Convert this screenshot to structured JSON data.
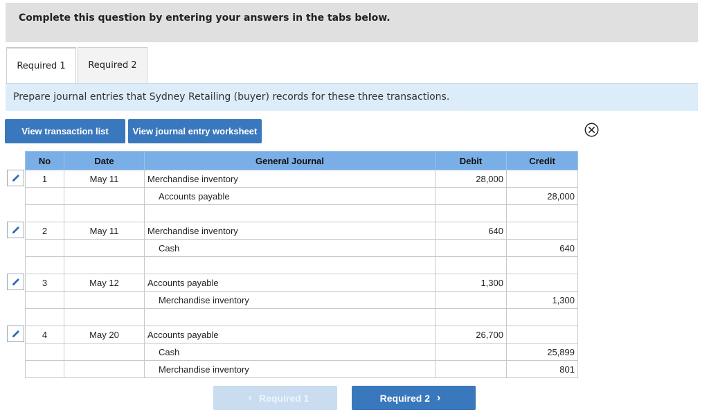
{
  "banner": {
    "text": "Complete this question by entering your answers in the tabs below."
  },
  "tabs": [
    {
      "label": "Required 1",
      "active": true
    },
    {
      "label": "Required 2",
      "active": false
    }
  ],
  "instruction": "Prepare journal entries that Sydney Retailing (buyer) records for these three transactions.",
  "buttons": {
    "transaction_list": "View transaction list",
    "journal_worksheet": "View journal entry worksheet"
  },
  "journal": {
    "headers": {
      "no": "No",
      "date": "Date",
      "general_journal": "General Journal",
      "debit": "Debit",
      "credit": "Credit"
    },
    "entries": [
      {
        "no": "1",
        "date": "May 11",
        "lines": [
          {
            "account": "Merchandise inventory",
            "debit": "28,000",
            "credit": ""
          },
          {
            "account": "Accounts payable",
            "debit": "",
            "credit": "28,000"
          }
        ]
      },
      {
        "no": "2",
        "date": "May 11",
        "lines": [
          {
            "account": "Merchandise inventory",
            "debit": "640",
            "credit": ""
          },
          {
            "account": "Cash",
            "debit": "",
            "credit": "640"
          }
        ]
      },
      {
        "no": "3",
        "date": "May 12",
        "lines": [
          {
            "account": "Accounts payable",
            "debit": "1,300",
            "credit": ""
          },
          {
            "account": "Merchandise inventory",
            "debit": "",
            "credit": "1,300"
          }
        ]
      },
      {
        "no": "4",
        "date": "May 20",
        "lines": [
          {
            "account": "Accounts payable",
            "debit": "26,700",
            "credit": ""
          },
          {
            "account": "Cash",
            "debit": "",
            "credit": "25,899"
          },
          {
            "account": "Merchandise inventory",
            "debit": "",
            "credit": "801"
          }
        ]
      }
    ]
  },
  "nav": {
    "prev_label": "Required 1",
    "next_label": "Required 2"
  },
  "icons": {
    "edit": "pencil-icon",
    "close": "close-circle-icon",
    "prev": "chevron-left-icon",
    "next": "chevron-right-icon"
  },
  "colors": {
    "button_blue": "#3a78bd",
    "header_blue": "#7aaee6",
    "instruction_bg": "#dcecf8",
    "banner_bg": "#e0e0e0"
  }
}
